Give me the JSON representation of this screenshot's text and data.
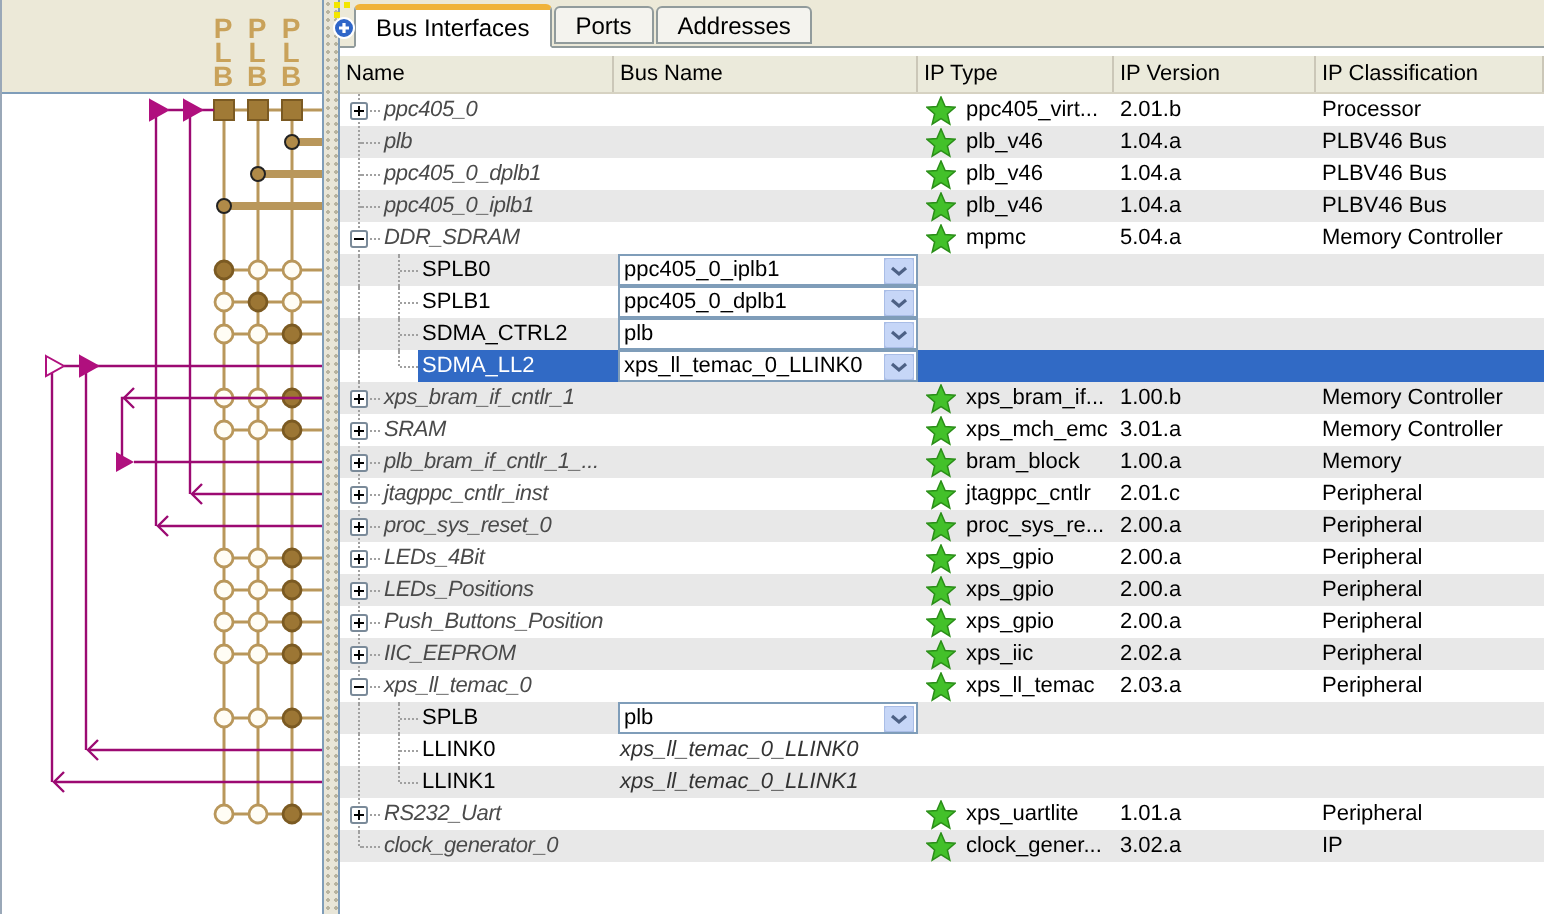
{
  "diagram": {
    "buses": [
      {
        "label": "PLB"
      },
      {
        "label": "PLB"
      },
      {
        "label": "PLB"
      }
    ]
  },
  "tabs": [
    {
      "label": "Bus Interfaces",
      "selected": true
    },
    {
      "label": "Ports",
      "selected": false
    },
    {
      "label": "Addresses",
      "selected": false
    }
  ],
  "table": {
    "columns": [
      "Name",
      "Bus Name",
      "IP Type",
      "IP Version",
      "IP Classification"
    ],
    "rows": [
      {
        "name": "ppc405_0",
        "expanded": false,
        "ip_type": "ppc405_virt...",
        "ip_version": "2.01.b",
        "ip_classification": "Processor",
        "selected": false,
        "diagram": {
          "kind": "master"
        }
      },
      {
        "name": "plb",
        "ip_type": "plb_v46",
        "ip_version": "1.04.a",
        "ip_classification": "PLBV46 Bus",
        "selected": false,
        "diagram": {
          "kind": "bus",
          "connections": [
            false,
            false,
            true
          ]
        }
      },
      {
        "name": "ppc405_0_dplb1",
        "ip_type": "plb_v46",
        "ip_version": "1.04.a",
        "ip_classification": "PLBV46 Bus",
        "selected": false,
        "diagram": {
          "kind": "bus",
          "connections": [
            false,
            true,
            false
          ]
        }
      },
      {
        "name": "ppc405_0_iplb1",
        "ip_type": "plb_v46",
        "ip_version": "1.04.a",
        "ip_classification": "PLBV46 Bus",
        "selected": false,
        "diagram": {
          "kind": "bus",
          "connections": [
            true,
            false,
            false
          ]
        }
      },
      {
        "name": "DDR_SDRAM",
        "expanded": true,
        "ip_type": "mpmc",
        "ip_version": "5.04.a",
        "ip_classification": "Memory Controller",
        "selected": false,
        "children": [
          {
            "name": "SPLB0",
            "bus_name": {
              "kind": "dropdown",
              "value": "ppc405_0_iplb1"
            },
            "selected": false,
            "diagram": {
              "kind": "slave",
              "connections": [
                true,
                false,
                false
              ]
            }
          },
          {
            "name": "SPLB1",
            "bus_name": {
              "kind": "dropdown",
              "value": "ppc405_0_dplb1"
            },
            "selected": false,
            "diagram": {
              "kind": "slave",
              "connections": [
                false,
                true,
                false
              ]
            }
          },
          {
            "name": "SDMA_CTRL2",
            "bus_name": {
              "kind": "dropdown",
              "value": "plb"
            },
            "selected": false,
            "diagram": {
              "kind": "slave",
              "connections": [
                false,
                false,
                true
              ]
            }
          },
          {
            "name": "SDMA_LL2",
            "bus_name": {
              "kind": "dropdown",
              "value": "xps_ll_temac_0_LLINK0"
            },
            "selected": true
          }
        ]
      },
      {
        "name": "xps_bram_if_cntlr_1",
        "expanded": false,
        "ip_type": "xps_bram_if...",
        "ip_version": "1.00.b",
        "ip_classification": "Memory Controller",
        "selected": false,
        "diagram": {
          "kind": "slave",
          "connections": [
            false,
            false,
            true
          ]
        }
      },
      {
        "name": "SRAM",
        "expanded": false,
        "ip_type": "xps_mch_emc",
        "ip_version": "3.01.a",
        "ip_classification": "Memory Controller",
        "selected": false,
        "diagram": {
          "kind": "slave",
          "connections": [
            false,
            false,
            true
          ]
        }
      },
      {
        "name": "plb_bram_if_cntlr_1_...",
        "expanded": false,
        "ip_type": "bram_block",
        "ip_version": "1.00.a",
        "ip_classification": "Memory",
        "selected": false
      },
      {
        "name": "jtagppc_cntlr_inst",
        "expanded": false,
        "ip_type": "jtagppc_cntlr",
        "ip_version": "2.01.c",
        "ip_classification": "Peripheral",
        "selected": false
      },
      {
        "name": "proc_sys_reset_0",
        "expanded": false,
        "ip_type": "proc_sys_re...",
        "ip_version": "2.00.a",
        "ip_classification": "Peripheral",
        "selected": false
      },
      {
        "name": "LEDs_4Bit",
        "expanded": false,
        "ip_type": "xps_gpio",
        "ip_version": "2.00.a",
        "ip_classification": "Peripheral",
        "selected": false,
        "diagram": {
          "kind": "slave",
          "connections": [
            false,
            false,
            true
          ]
        }
      },
      {
        "name": "LEDs_Positions",
        "expanded": false,
        "ip_type": "xps_gpio",
        "ip_version": "2.00.a",
        "ip_classification": "Peripheral",
        "selected": false,
        "diagram": {
          "kind": "slave",
          "connections": [
            false,
            false,
            true
          ]
        }
      },
      {
        "name": "Push_Buttons_Position",
        "expanded": false,
        "ip_type": "xps_gpio",
        "ip_version": "2.00.a",
        "ip_classification": "Peripheral",
        "selected": false,
        "diagram": {
          "kind": "slave",
          "connections": [
            false,
            false,
            true
          ]
        }
      },
      {
        "name": "IIC_EEPROM",
        "expanded": false,
        "ip_type": "xps_iic",
        "ip_version": "2.02.a",
        "ip_classification": "Peripheral",
        "selected": false,
        "diagram": {
          "kind": "slave",
          "connections": [
            false,
            false,
            true
          ]
        }
      },
      {
        "name": "xps_ll_temac_0",
        "expanded": true,
        "ip_type": "xps_ll_temac",
        "ip_version": "2.03.a",
        "ip_classification": "Peripheral",
        "selected": false,
        "children": [
          {
            "name": "SPLB",
            "bus_name": {
              "kind": "dropdown",
              "value": "plb"
            },
            "selected": false,
            "diagram": {
              "kind": "slave",
              "connections": [
                false,
                false,
                true
              ]
            }
          },
          {
            "name": "LLINK0",
            "bus_name": {
              "kind": "text",
              "value": "xps_ll_temac_0_LLINK0"
            },
            "selected": false
          },
          {
            "name": "LLINK1",
            "bus_name": {
              "kind": "text",
              "value": "xps_ll_temac_0_LLINK1"
            },
            "selected": false
          }
        ]
      },
      {
        "name": "RS232_Uart",
        "expanded": false,
        "ip_type": "xps_uartlite",
        "ip_version": "1.01.a",
        "ip_classification": "Peripheral",
        "selected": false,
        "diagram": {
          "kind": "slave",
          "connections": [
            false,
            false,
            true
          ]
        }
      },
      {
        "name": "clock_generator_0",
        "ip_type": "clock_gener...",
        "ip_version": "3.02.a",
        "ip_classification": "IP",
        "selected": false
      }
    ]
  }
}
